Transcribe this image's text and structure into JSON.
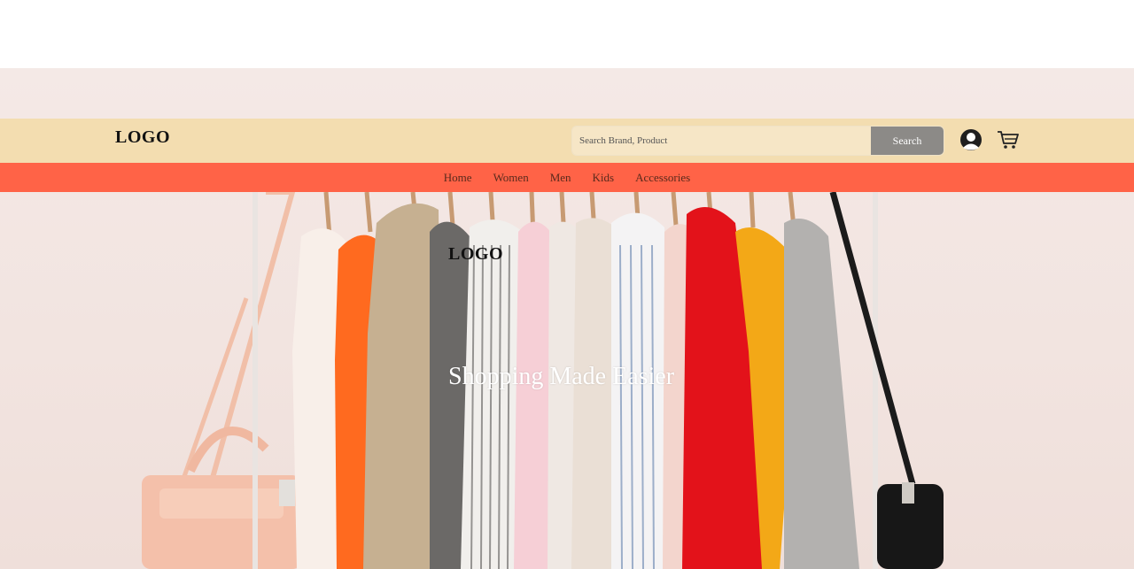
{
  "header": {
    "logo": "LOGO",
    "search": {
      "placeholder": "Search Brand, Product",
      "value": "",
      "button_label": "Search"
    },
    "icons": {
      "account": "user-icon",
      "cart": "cart-icon"
    }
  },
  "nav": {
    "items": [
      {
        "label": "Home"
      },
      {
        "label": "Women"
      },
      {
        "label": "Men"
      },
      {
        "label": "Kids"
      },
      {
        "label": "Accessories"
      }
    ]
  },
  "hero": {
    "logo": "LOGO",
    "tagline": "Shopping Made Easier"
  },
  "colors": {
    "header_bg": "#f3ddb0",
    "nav_bg": "#ff6347",
    "nav_text": "#5a2a1c",
    "search_button_bg": "#8c8a87"
  }
}
